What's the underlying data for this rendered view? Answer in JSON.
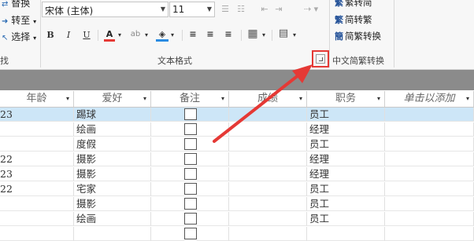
{
  "ribbon": {
    "left_buttons": [
      {
        "label": "替换",
        "icon": "replace-icon"
      },
      {
        "label": "转至",
        "icon": "goto-icon",
        "has_dropdown": true
      },
      {
        "label": "选择",
        "icon": "select-icon",
        "has_dropdown": true
      }
    ],
    "left_group_label_fragment": "找",
    "font_name": "宋体 (主体)",
    "font_size": "11",
    "text_format_group_label": "文本格式",
    "format_buttons": {
      "bold": "B",
      "italic": "I",
      "underline": "U",
      "font_color": "A",
      "background_color": "ab",
      "align_left": "≡",
      "align_center": "≡",
      "align_right": "≡"
    },
    "chinese_conversion": {
      "buttons": [
        "繁转简",
        "简转繁",
        "简繁转换"
      ],
      "group_label": "中文简繁转换"
    }
  },
  "table": {
    "headers": [
      "年龄",
      "爱好",
      "备注",
      "成绩",
      "职务",
      "单击以添加"
    ],
    "rows": [
      {
        "age": "23",
        "hobby": "踢球",
        "job": "员工",
        "selected": true
      },
      {
        "age": "",
        "hobby": "绘画",
        "job": "经理",
        "selected": false
      },
      {
        "age": "",
        "hobby": "度假",
        "job": "员工",
        "selected": false
      },
      {
        "age": "22",
        "hobby": "摄影",
        "job": "经理",
        "selected": false
      },
      {
        "age": "23",
        "hobby": "摄影",
        "job": "经理",
        "selected": false
      },
      {
        "age": "22",
        "hobby": "宅家",
        "job": "员工",
        "selected": false
      },
      {
        "age": "",
        "hobby": "摄影",
        "job": "员工",
        "selected": false
      },
      {
        "age": "",
        "hobby": "绘画",
        "job": "员工",
        "selected": false
      },
      {
        "age": "",
        "hobby": "",
        "job": "",
        "selected": false
      }
    ]
  },
  "colors": {
    "annotation_red": "#e53935",
    "selected_row": "#cde6f7",
    "band": "#8b8b8b"
  }
}
